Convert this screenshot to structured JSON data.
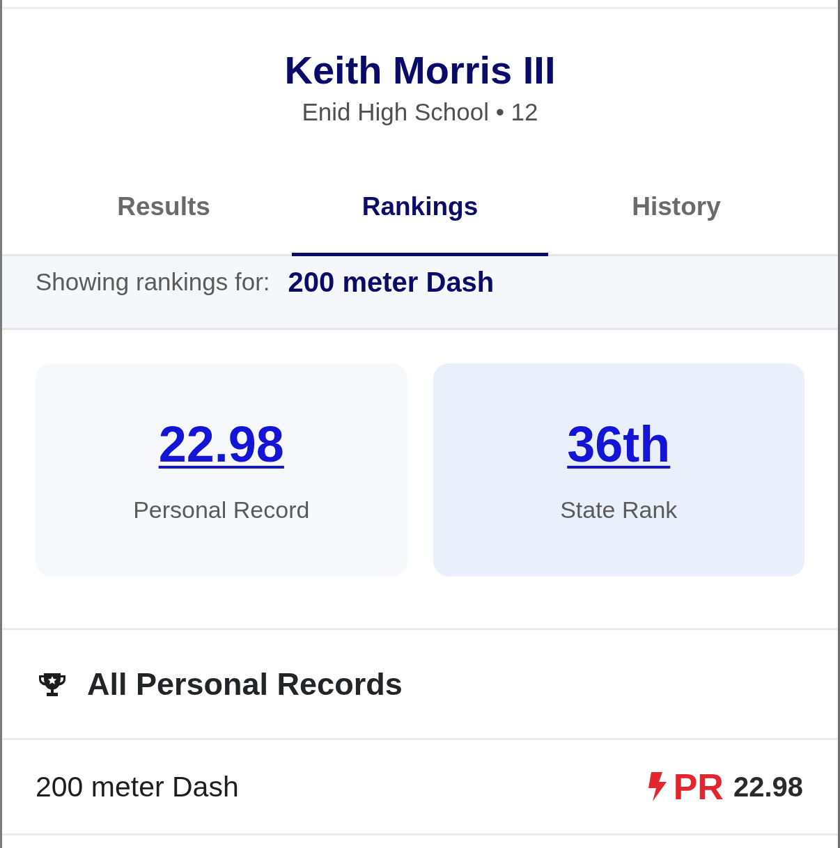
{
  "athlete": {
    "name": "Keith Morris III",
    "subtitle": "Enid High School • 12"
  },
  "tabs": [
    {
      "label": "Results",
      "selected": false
    },
    {
      "label": "Rankings",
      "selected": true
    },
    {
      "label": "History",
      "selected": false
    }
  ],
  "event_filter": {
    "label": "Showing rankings for:",
    "value": "200 meter Dash"
  },
  "stats": [
    {
      "value": "22.98",
      "label": "Personal Record",
      "highlighted": false
    },
    {
      "value": "36th",
      "label": "State Rank",
      "highlighted": true
    }
  ],
  "records": {
    "title": "All Personal Records",
    "rows": [
      {
        "event": "200 meter Dash",
        "badge": "PR",
        "mark": "22.98"
      }
    ]
  }
}
